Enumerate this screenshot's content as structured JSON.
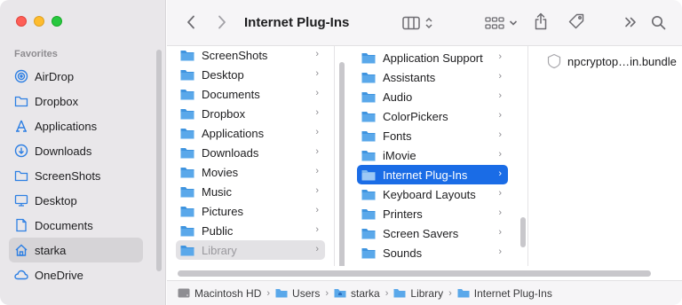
{
  "window": {
    "title": "Internet Plug-Ins"
  },
  "colors": {
    "accent": "#1a6ce6",
    "folder": "#5aa8ea",
    "sidebar_icon": "#2d7fe3"
  },
  "sidebar": {
    "section_label": "Favorites",
    "items": [
      {
        "label": "AirDrop",
        "icon": "airdrop-icon"
      },
      {
        "label": "Dropbox",
        "icon": "folder-icon"
      },
      {
        "label": "Applications",
        "icon": "applications-icon"
      },
      {
        "label": "Downloads",
        "icon": "downloads-icon"
      },
      {
        "label": "ScreenShots",
        "icon": "folder-icon"
      },
      {
        "label": "Desktop",
        "icon": "desktop-icon"
      },
      {
        "label": "Documents",
        "icon": "document-icon"
      },
      {
        "label": "starka",
        "icon": "home-icon",
        "selected": true
      },
      {
        "label": "OneDrive",
        "icon": "cloud-icon"
      }
    ]
  },
  "toolbar": {
    "back_icon": "chevron-left-icon",
    "forward_icon": "chevron-right-icon",
    "view_icon": "columns-view-icon",
    "group_icon": "grid-icon",
    "share_icon": "share-icon",
    "tag_icon": "tag-icon",
    "more_icon": "chevron-double-right-icon",
    "search_icon": "search-icon"
  },
  "column1": {
    "items": [
      {
        "label": "ScreenShots"
      },
      {
        "label": "Desktop"
      },
      {
        "label": "Documents"
      },
      {
        "label": "Dropbox"
      },
      {
        "label": "Applications"
      },
      {
        "label": "Downloads"
      },
      {
        "label": "Movies"
      },
      {
        "label": "Music"
      },
      {
        "label": "Pictures"
      },
      {
        "label": "Public"
      },
      {
        "label": "Library",
        "state": "dim"
      }
    ]
  },
  "column2": {
    "items": [
      {
        "label": "Application Support"
      },
      {
        "label": "Assistants"
      },
      {
        "label": "Audio"
      },
      {
        "label": "ColorPickers"
      },
      {
        "label": "Fonts"
      },
      {
        "label": "iMovie"
      },
      {
        "label": "Internet Plug-Ins",
        "state": "active"
      },
      {
        "label": "Keyboard Layouts"
      },
      {
        "label": "Printers"
      },
      {
        "label": "Screen Savers"
      },
      {
        "label": "Sounds"
      }
    ]
  },
  "column3": {
    "items": [
      {
        "label": "npcryptop…in.bundle"
      }
    ]
  },
  "pathbar": {
    "items": [
      {
        "label": "Macintosh HD"
      },
      {
        "label": "Users"
      },
      {
        "label": "starka"
      },
      {
        "label": "Library"
      },
      {
        "label": "Internet Plug-Ins"
      }
    ]
  }
}
